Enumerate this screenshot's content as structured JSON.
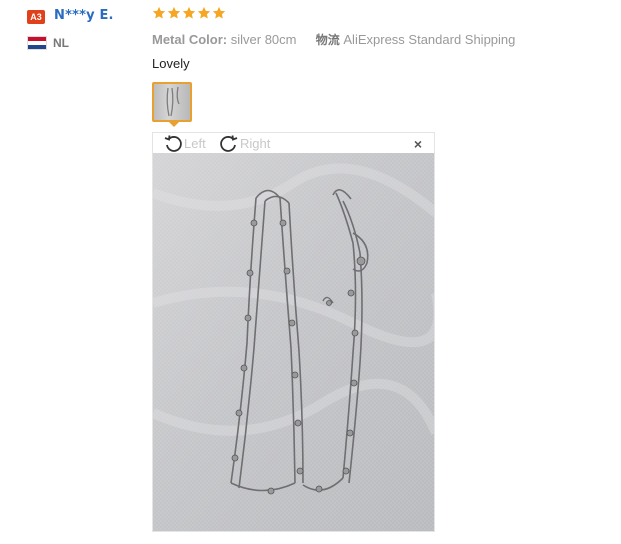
{
  "buyer": {
    "level_badge": "A3",
    "name": "N***y E.",
    "country": "NL",
    "flag_colors": [
      "#c8102e",
      "#ffffff",
      "#21468b"
    ]
  },
  "review": {
    "rating": 5,
    "star_color": "#f5a623",
    "attribute_label": "Metal Color:",
    "attribute_value": "silver 80cm",
    "shipping_label": "物流",
    "shipping_value": "AliExpress Standard Shipping",
    "text": "Lovely"
  },
  "viewer": {
    "rotate_left_label": "Left",
    "rotate_right_label": "Right",
    "close_label": "×",
    "thumbnail_icon": "photo-thumbnail",
    "rotate_left_icon": "rotate-left-icon",
    "rotate_right_icon": "rotate-right-icon"
  }
}
